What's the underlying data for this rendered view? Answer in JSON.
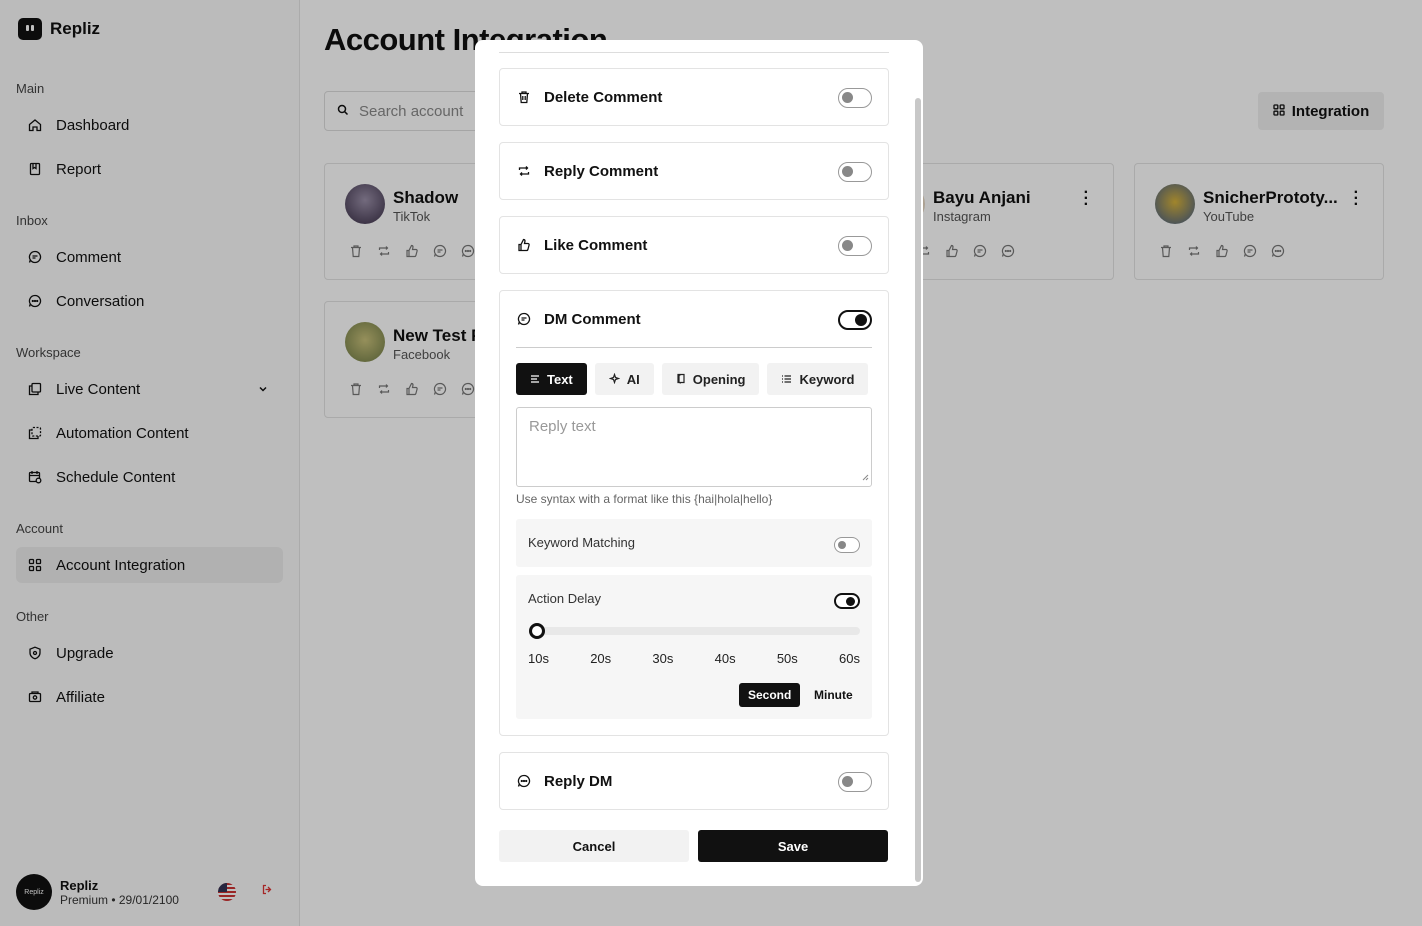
{
  "app": {
    "name": "Repliz"
  },
  "sidebar": {
    "sections": [
      {
        "label": "Main"
      },
      {
        "label": "Inbox"
      },
      {
        "label": "Workspace"
      },
      {
        "label": "Account"
      },
      {
        "label": "Other"
      }
    ],
    "items": [
      {
        "label": "Dashboard",
        "icon": "home-icon"
      },
      {
        "label": "Report",
        "icon": "report-icon"
      },
      {
        "label": "Comment",
        "icon": "comment-icon"
      },
      {
        "label": "Conversation",
        "icon": "conversation-icon"
      },
      {
        "label": "Live Content",
        "icon": "live-content-icon"
      },
      {
        "label": "Automation Content",
        "icon": "automation-icon"
      },
      {
        "label": "Schedule Content",
        "icon": "schedule-icon"
      },
      {
        "label": "Account Integration",
        "icon": "grid-icon",
        "active": true
      },
      {
        "label": "Upgrade",
        "icon": "shield-icon"
      },
      {
        "label": "Affiliate",
        "icon": "affiliate-icon"
      }
    ]
  },
  "user": {
    "avatar_text": "Repliz",
    "name": "Repliz",
    "status": "Premium • 29/01/2100"
  },
  "page": {
    "title": "Account Integration",
    "search_placeholder": "Search account",
    "integration_button": "Integration"
  },
  "accounts": [
    {
      "name": "Shadow",
      "platform": "TikTok"
    },
    {
      "name": "Bayu Anjani",
      "platform": "Instagram"
    },
    {
      "name": "SnicherPrototy...",
      "platform": "YouTube"
    },
    {
      "name": "New Test P",
      "platform": "Facebook"
    }
  ],
  "modal": {
    "sections": [
      {
        "label": "Delete Comment",
        "enabled": false
      },
      {
        "label": "Reply Comment",
        "enabled": false
      },
      {
        "label": "Like Comment",
        "enabled": false
      }
    ],
    "dm": {
      "label": "DM Comment",
      "enabled": true,
      "tabs": [
        {
          "label": "Text",
          "active": true
        },
        {
          "label": "AI"
        },
        {
          "label": "Opening"
        },
        {
          "label": "Keyword"
        }
      ],
      "reply_placeholder": "Reply text",
      "hint": "Use syntax with a format like this {hai|hola|hello}",
      "keyword_matching": {
        "label": "Keyword Matching",
        "enabled": false
      },
      "action_delay": {
        "label": "Action Delay",
        "enabled": true,
        "value": 10,
        "ticks": [
          "10s",
          "20s",
          "30s",
          "40s",
          "50s",
          "60s"
        ],
        "units": [
          "Second",
          "Minute"
        ],
        "selected_unit": "Second"
      }
    },
    "reply_dm": {
      "label": "Reply DM",
      "enabled": false
    },
    "cancel_label": "Cancel",
    "save_label": "Save"
  },
  "colors": {
    "accent": "#111111",
    "overlay": "rgba(0,0,0,0.25)"
  }
}
